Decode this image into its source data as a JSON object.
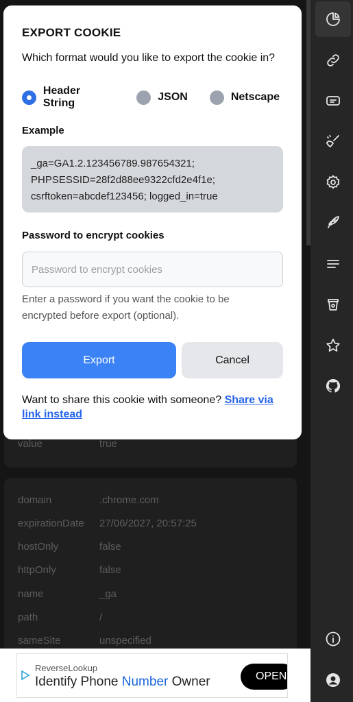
{
  "modal": {
    "title": "EXPORT COOKIE",
    "question": "Which format would you like to export the cookie in?",
    "formats": [
      {
        "label": "Header String",
        "selected": true
      },
      {
        "label": "JSON",
        "selected": false
      },
      {
        "label": "Netscape",
        "selected": false
      }
    ],
    "example_label": "Example",
    "example_lines": [
      "_ga=GA1.2.123456789.987654321;",
      "PHPSESSID=28f2d88ee9322cfd2e4f1e;",
      "csrftoken=abcdef123456; logged_in=true"
    ],
    "password_label": "Password to encrypt cookies",
    "password_placeholder": "Password to encrypt cookies",
    "password_value": "",
    "hint": "Enter a password if you want the cookie to be encrypted before export (optional).",
    "export_label": "Export",
    "cancel_label": "Cancel",
    "share_text": "Want to share this cookie with someone?",
    "share_link": "Share via link instead"
  },
  "background": {
    "card_a": [
      {
        "key": "value",
        "value": "true"
      }
    ],
    "card_b": [
      {
        "key": "domain",
        "value": ".chrome.com"
      },
      {
        "key": "expirationDate",
        "value": "27/06/2027, 20:57:25"
      },
      {
        "key": "hostOnly",
        "value": "false"
      },
      {
        "key": "httpOnly",
        "value": "false"
      },
      {
        "key": "name",
        "value": "_ga"
      },
      {
        "key": "path",
        "value": "/"
      },
      {
        "key": "sameSite",
        "value": "unspecified"
      }
    ]
  },
  "sidebar": {
    "items": [
      {
        "icon": "pie-chart-icon",
        "active": true
      },
      {
        "icon": "link-icon",
        "active": false
      },
      {
        "icon": "ticket-icon",
        "active": false
      },
      {
        "icon": "broom-icon",
        "active": false
      },
      {
        "icon": "gear-icon",
        "active": false
      },
      {
        "icon": "rocket-icon",
        "active": false
      },
      {
        "icon": "menu-lines-icon",
        "active": false
      },
      {
        "icon": "coffee-cup-icon",
        "active": false
      },
      {
        "icon": "star-icon",
        "active": false
      },
      {
        "icon": "github-icon",
        "active": false
      },
      {
        "icon": "info-icon",
        "active": false
      },
      {
        "icon": "user-icon",
        "active": false
      }
    ]
  },
  "ad": {
    "brand": "ReverseLookup",
    "headline_pre": "Identify Phone ",
    "headline_highlight": "Number",
    "headline_post": " Owner",
    "cta": "OPEN"
  },
  "colors": {
    "accent": "#3b82f6",
    "radio_selected": "#2f6fe4",
    "link": "#2563eb",
    "rail_bg": "#262626"
  }
}
